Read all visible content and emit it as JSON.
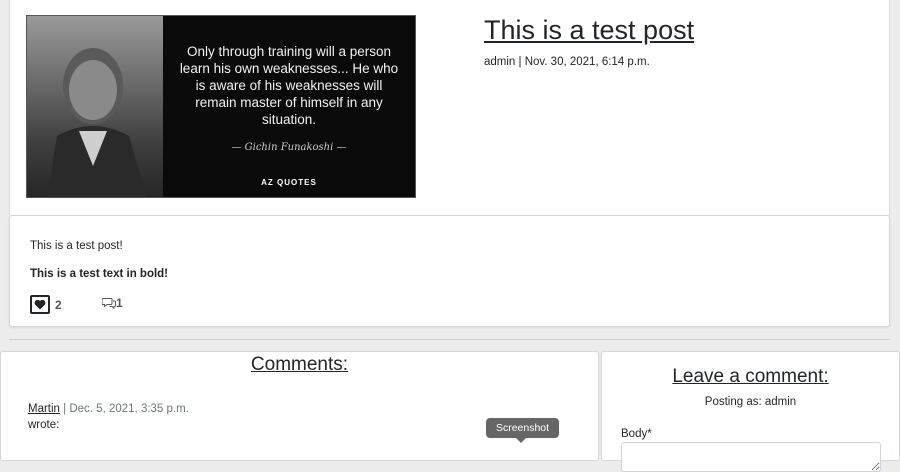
{
  "post": {
    "title": "This is a test post",
    "meta": "admin | Nov. 30, 2021, 6:14 p.m.",
    "image": {
      "quote": "Only through training will a person learn his own weaknesses... He who is aware of his weaknesses will remain master of himself in any situation.",
      "author": "— Gichin Funakoshi —",
      "brand": "AZ QUOTES"
    },
    "body_line1": "This is a test post!",
    "body_line2": "This is a test text in bold!",
    "likes": "2",
    "comments_count": "1",
    "like_icon": "heart-icon",
    "comment_icon": "speech-bubbles-icon"
  },
  "comments": {
    "title": "Comments:",
    "items": [
      {
        "author": "Martin",
        "date": "| Dec. 5, 2021, 3:35 p.m.",
        "wrote": "wrote:"
      }
    ]
  },
  "leave_comment": {
    "title": "Leave a comment:",
    "posting_as": "Posting as: admin",
    "body_label": "Body*",
    "body_value": ""
  },
  "tooltip": {
    "text": "Screenshot"
  }
}
